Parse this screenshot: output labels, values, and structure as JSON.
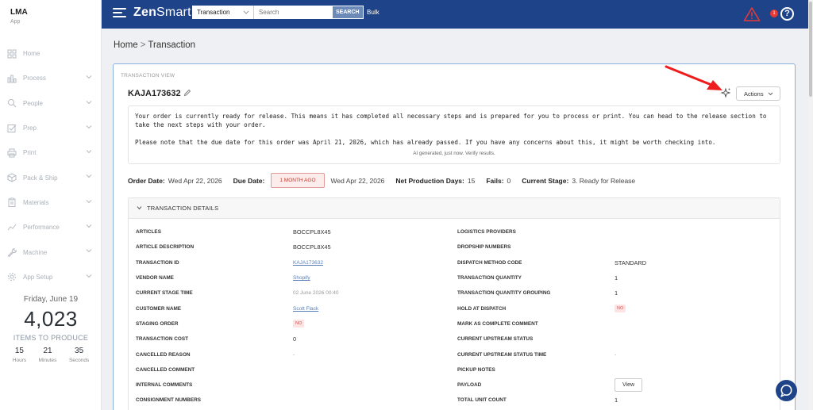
{
  "sidebar": {
    "brand": "LMA",
    "brand_sub": "App",
    "items": [
      {
        "label": "Home",
        "icon": "grid-icon",
        "chevron": false
      },
      {
        "label": "Process",
        "icon": "bar-chart-icon",
        "chevron": true
      },
      {
        "label": "People",
        "icon": "search-person-icon",
        "chevron": true
      },
      {
        "label": "Prep",
        "icon": "checkbox-icon",
        "chevron": true
      },
      {
        "label": "Print",
        "icon": "printer-icon",
        "chevron": true
      },
      {
        "label": "Pack & Ship",
        "icon": "box-icon",
        "chevron": true
      },
      {
        "label": "Materials",
        "icon": "clipboard-icon",
        "chevron": true
      },
      {
        "label": "Performance",
        "icon": "line-chart-icon",
        "chevron": true
      },
      {
        "label": "Machine",
        "icon": "wrench-icon",
        "chevron": true
      },
      {
        "label": "App Setup",
        "icon": "gear-icon",
        "chevron": true
      }
    ],
    "counter": {
      "date": "Friday, June 19",
      "number": "4,023",
      "label": "ITEMS TO PRODUCE",
      "hours": "15",
      "hours_label": "Hours",
      "minutes": "21",
      "minutes_label": "Minutes",
      "seconds": "35",
      "seconds_label": "Seconds"
    }
  },
  "header": {
    "logo_bold": "Zen",
    "logo_light": "Smart",
    "search_type": "Transaction",
    "search_placeholder": "Search",
    "search_button": "SEARCH",
    "bulk": "Bulk",
    "notification_count": "1",
    "help": "?",
    "colors": {
      "bar": "#1e4388",
      "alert": "#e53935"
    }
  },
  "breadcrumb": {
    "home": "Home",
    "sep": ">",
    "current": "Transaction"
  },
  "card": {
    "section_label": "TRANSACTION VIEW",
    "title": "KAJA173632",
    "actions_label": "Actions",
    "ai_paragraph_1": "Your order is currently ready for release. This means it has completed all necessary steps and is prepared for you to process or print. You can head to the release section to take the next steps with your order.",
    "ai_paragraph_2": "Please note that the due date for this order was April 21, 2026, which has already passed. If you have any concerns about this, it might be worth checking into.",
    "ai_footer": "AI generated, just now. Verify results.",
    "summary": {
      "order_date_label": "Order Date:",
      "order_date": "Wed Apr 22, 2026",
      "due_date_label": "Due Date:",
      "due_badge": "1 MONTH AGO",
      "due_date": "Wed Apr 22, 2026",
      "net_days_label": "Net Production Days:",
      "net_days": "15",
      "fails_label": "Fails:",
      "fails": "0",
      "stage_label": "Current Stage:",
      "stage": "3. Ready for Release"
    },
    "details_title": "TRANSACTION DETAILS",
    "left_rows": [
      {
        "k": "ARTICLES",
        "v": "BOCCPL8X45"
      },
      {
        "k": "ARTICLE DESCRIPTION",
        "v": "BOCCPL8X45"
      },
      {
        "k": "TRANSACTION ID",
        "v": "KAJA173632"
      },
      {
        "k": "VENDOR NAME",
        "v": "Shopify"
      },
      {
        "k": "CURRENT STAGE TIME",
        "v": "02 June 2026 00:40"
      },
      {
        "k": "CUSTOMER NAME",
        "v": "Scott Flack"
      },
      {
        "k": "STAGING ORDER",
        "v": "NO"
      },
      {
        "k": "TRANSACTION COST",
        "v": "0"
      },
      {
        "k": "CANCELLED REASON",
        "v": "-"
      },
      {
        "k": "CANCELLED COMMENT",
        "v": ""
      },
      {
        "k": "INTERNAL COMMENTS",
        "v": ""
      },
      {
        "k": "CONSIGNMENT NUMBERS",
        "v": ""
      }
    ],
    "right_rows": [
      {
        "k": "LOGISTICS PROVIDERS",
        "v": ""
      },
      {
        "k": "DROPSHIP NUMBERS",
        "v": ""
      },
      {
        "k": "DISPATCH METHOD CODE",
        "v": "STANDARD"
      },
      {
        "k": "TRANSACTION QUANTITY",
        "v": "1"
      },
      {
        "k": "TRANSACTION QUANTITY GROUPING",
        "v": "1"
      },
      {
        "k": "HOLD AT DISPATCH",
        "v": "NO"
      },
      {
        "k": "MARK AS COMPLETE COMMENT",
        "v": ""
      },
      {
        "k": "CURRENT UPSTREAM STATUS",
        "v": ""
      },
      {
        "k": "CURRENT UPSTREAM STATUS TIME",
        "v": "-"
      },
      {
        "k": "PICKUP NOTES",
        "v": ""
      },
      {
        "k": "PAYLOAD",
        "v": "View"
      },
      {
        "k": "TOTAL UNIT COUNT",
        "v": "1"
      }
    ]
  }
}
